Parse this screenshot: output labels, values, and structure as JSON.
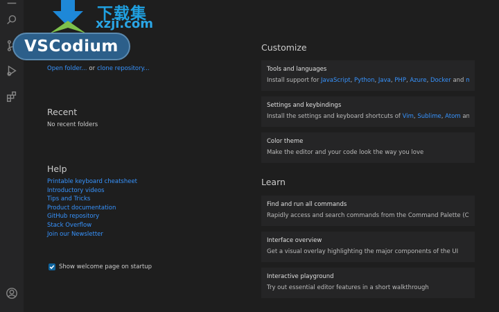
{
  "watermark": {
    "brand_cn": "下载集",
    "url": "xzji.com"
  },
  "brand": {
    "name": "VSCodium"
  },
  "start": {
    "open_folder": "Open folder...",
    "or": "or",
    "clone_repo": "clone repository..."
  },
  "recent": {
    "title": "Recent",
    "empty": "No recent folders"
  },
  "help": {
    "title": "Help",
    "links": [
      "Printable keyboard cheatsheet",
      "Introductory videos",
      "Tips and Tricks",
      "Product documentation",
      "GitHub repository",
      "Stack Overflow",
      "Join our Newsletter"
    ]
  },
  "startup": {
    "label": "Show welcome page on startup",
    "checked": true
  },
  "customize": {
    "title": "Customize",
    "tools": {
      "title": "Tools and languages",
      "prefix": "Install support for",
      "items": [
        "JavaScript",
        "Python",
        "Java",
        "PHP",
        "Azure",
        "Docker"
      ],
      "and": "and",
      "more": "more"
    },
    "keybindings": {
      "title": "Settings and keybindings",
      "prefix": "Install the settings and keyboard shortcuts of",
      "items": [
        "Vim",
        "Sublime",
        "Atom"
      ],
      "suffix": "and ..."
    },
    "theme": {
      "title": "Color theme",
      "desc": "Make the editor and your code look the way you love"
    }
  },
  "learn": {
    "title": "Learn",
    "cards": [
      {
        "title": "Find and run all commands",
        "desc": "Rapidly access and search commands from the Command Palette (Ctrl..."
      },
      {
        "title": "Interface overview",
        "desc": "Get a visual overlay highlighting the major components of the UI"
      },
      {
        "title": "Interactive playground",
        "desc": "Try out essential editor features in a short walkthrough"
      }
    ]
  },
  "colors": {
    "link": "#3794ff",
    "bg": "#1e1e1e",
    "activity_bar": "#252526",
    "card": "#252526"
  }
}
